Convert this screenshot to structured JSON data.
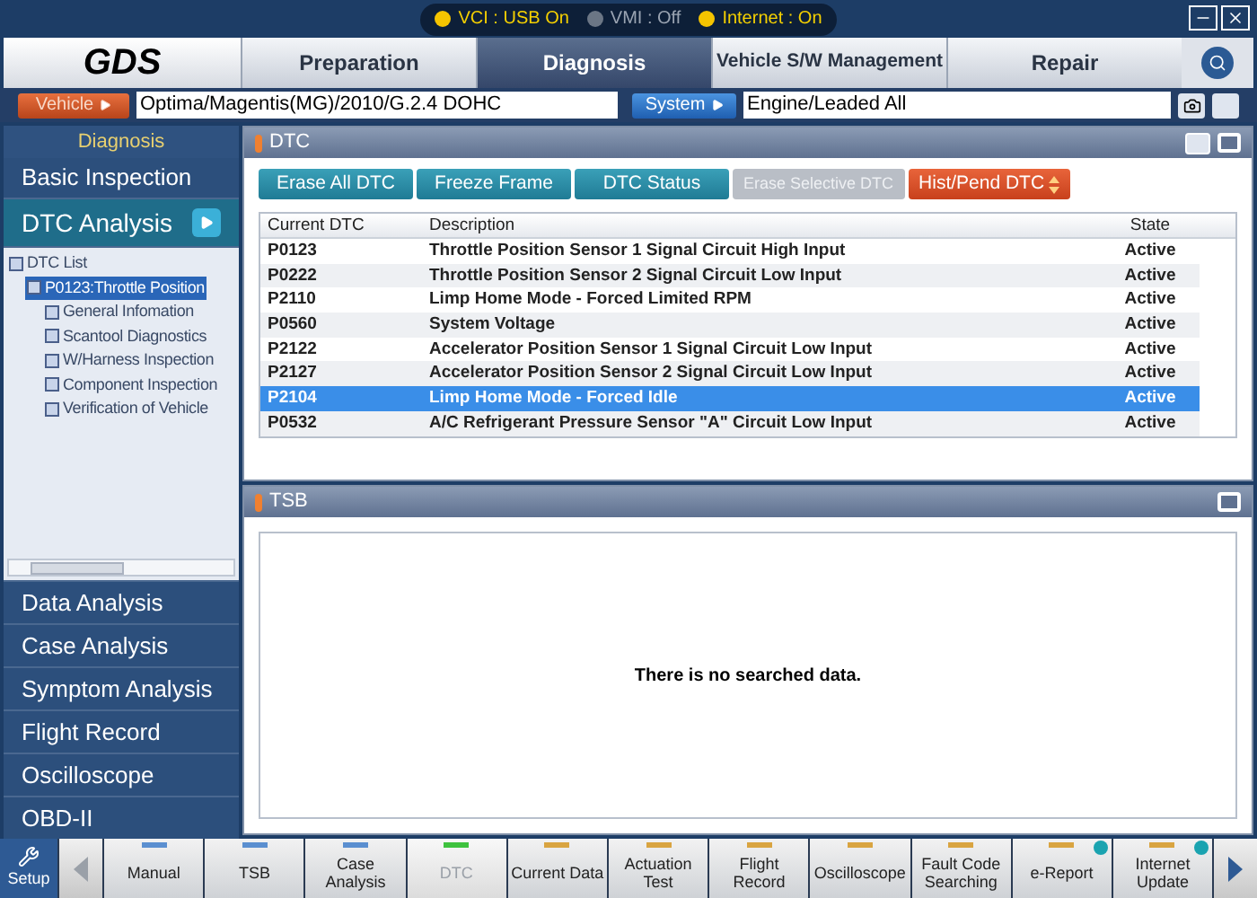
{
  "status": [
    {
      "label": "VCI : USB On",
      "on": true
    },
    {
      "label": "VMI : Off",
      "on": false
    },
    {
      "label": "Internet : On",
      "on": true
    }
  ],
  "logo": "GDS",
  "tabs": [
    {
      "label": "Preparation",
      "selected": false
    },
    {
      "label": "Diagnosis",
      "selected": true
    },
    {
      "label": "Vehicle S/W Management",
      "selected": false
    },
    {
      "label": "Repair",
      "selected": false
    }
  ],
  "vehicle": {
    "label": "Vehicle",
    "value": "Optima/Magentis(MG)/2010/G.2.4 DOHC"
  },
  "system": {
    "label": "System",
    "value": "Engine/Leaded All"
  },
  "sidebar": {
    "title": "Diagnosis",
    "top_items": [
      {
        "label": "Basic Inspection",
        "selected": false
      },
      {
        "label": "DTC Analysis",
        "selected": true
      }
    ],
    "tree": [
      {
        "label": "DTC List",
        "selected": false,
        "children": [
          {
            "label": "P0123:Throttle Position",
            "selected": true,
            "children": [
              {
                "label": "General Infomation",
                "selected": false
              },
              {
                "label": "Scantool Diagnostics",
                "selected": false
              },
              {
                "label": "W/Harness Inspection",
                "selected": false
              },
              {
                "label": "Component Inspection",
                "selected": false
              },
              {
                "label": "Verification of Vehicle",
                "selected": false
              }
            ]
          }
        ]
      }
    ],
    "bottom_items": [
      {
        "label": "Data Analysis",
        "selected": false
      },
      {
        "label": "Case Analysis",
        "selected": false
      },
      {
        "label": "Symptom Analysis",
        "selected": false
      },
      {
        "label": "Flight Record",
        "selected": false
      },
      {
        "label": "Oscilloscope",
        "selected": false
      },
      {
        "label": "OBD-II",
        "selected": false
      }
    ]
  },
  "dtc_panel": {
    "title": "DTC",
    "buttons": [
      {
        "label": "Erase All DTC",
        "kind": "normal"
      },
      {
        "label": "Freeze Frame",
        "kind": "normal"
      },
      {
        "label": "DTC Status",
        "kind": "normal"
      },
      {
        "label": "Erase Selective DTC",
        "kind": "disabled"
      },
      {
        "label": "Hist/Pend DTC",
        "kind": "dropdown"
      }
    ],
    "columns": [
      "Current DTC",
      "Description",
      "State"
    ],
    "rows": [
      {
        "cells": [
          "P0123",
          "Throttle Position Sensor 1 Signal Circuit High Input",
          "Active"
        ],
        "selected": false
      },
      {
        "cells": [
          "P0222",
          "Throttle Position Sensor 2 Signal Circuit Low Input",
          "Active"
        ],
        "selected": false
      },
      {
        "cells": [
          "P2110",
          "Limp Home Mode - Forced Limited RPM",
          "Active"
        ],
        "selected": false
      },
      {
        "cells": [
          "P0560",
          "System Voltage",
          "Active"
        ],
        "selected": false
      },
      {
        "cells": [
          "P2122",
          "Accelerator Position Sensor 1 Signal Circuit Low Input",
          "Active"
        ],
        "selected": false
      },
      {
        "cells": [
          "P2127",
          "Accelerator Position Sensor 2 Signal Circuit Low Input",
          "Active"
        ],
        "selected": false
      },
      {
        "cells": [
          "P2104",
          "Limp Home Mode - Forced Idle",
          "Active"
        ],
        "selected": true
      },
      {
        "cells": [
          "P0532",
          "A/C Refrigerant Pressure Sensor \"A\" Circuit Low Input",
          "Active"
        ],
        "selected": false
      }
    ]
  },
  "tsb_panel": {
    "title": "TSB",
    "message": "There is no searched data."
  },
  "toolbar": {
    "setup": "Setup",
    "items": [
      {
        "label": "Manual",
        "color": "#5b8fd0",
        "selected": false,
        "info": false
      },
      {
        "label": "TSB",
        "color": "#5b8fd0",
        "selected": false,
        "info": false
      },
      {
        "label": "Case Analysis",
        "color": "#5b8fd0",
        "selected": false,
        "info": false
      },
      {
        "label": "DTC",
        "color": "#3fc23f",
        "selected": true,
        "info": false
      },
      {
        "label": "Current Data",
        "color": "#d9a441",
        "selected": false,
        "info": false
      },
      {
        "label": "Actuation Test",
        "color": "#d9a441",
        "selected": false,
        "info": false
      },
      {
        "label": "Flight Record",
        "color": "#d9a441",
        "selected": false,
        "info": false
      },
      {
        "label": "Oscilloscope",
        "color": "#d9a441",
        "selected": false,
        "info": false
      },
      {
        "label": "Fault Code Searching",
        "color": "#d9a441",
        "selected": false,
        "info": false
      },
      {
        "label": "e-Report",
        "color": "#d9a441",
        "selected": false,
        "info": true
      },
      {
        "label": "Internet Update",
        "color": "#d9a441",
        "selected": false,
        "info": true
      }
    ]
  }
}
